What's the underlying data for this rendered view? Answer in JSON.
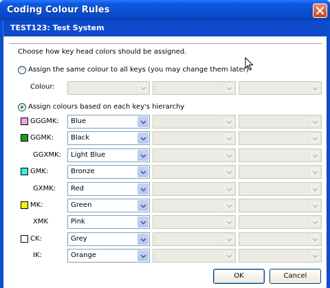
{
  "window": {
    "title": "Coding Colour Rules",
    "subtitle": "TEST123: Test System"
  },
  "instruction": "Choose how key head colors should be assigned.",
  "option_same": {
    "label": "Assign the same colour to all keys (you may change them later)",
    "selected": false,
    "colour_label": "Colour:"
  },
  "option_hierarchy": {
    "label": "Assign colours based on each key's hierarchy",
    "selected": true
  },
  "rows": [
    {
      "label": "GGGMK:",
      "value": "Blue",
      "swatch": "#f0a0e8"
    },
    {
      "label": "GGMK:",
      "value": "Black",
      "swatch": "#1ea01e"
    },
    {
      "label": "GGXMK:",
      "value": "Light Blue",
      "swatch": null
    },
    {
      "label": "GMK:",
      "value": "Bronze",
      "swatch": "#40e8e0"
    },
    {
      "label": "GXMK:",
      "value": "Red",
      "swatch": null
    },
    {
      "label": "MK:",
      "value": "Green",
      "swatch": "#f8f000"
    },
    {
      "label": "XMK",
      "value": "Pink",
      "swatch": null
    },
    {
      "label": "CK:",
      "value": "Grey",
      "swatch": "#ffffff"
    },
    {
      "label": "IK:",
      "value": "Orange",
      "swatch": null
    }
  ],
  "buttons": {
    "ok": "OK",
    "cancel": "Cancel"
  },
  "colors": {
    "title_bar": "#0a4fcf",
    "subheader": "#0e4bcc",
    "close_button": "#c9421f"
  }
}
